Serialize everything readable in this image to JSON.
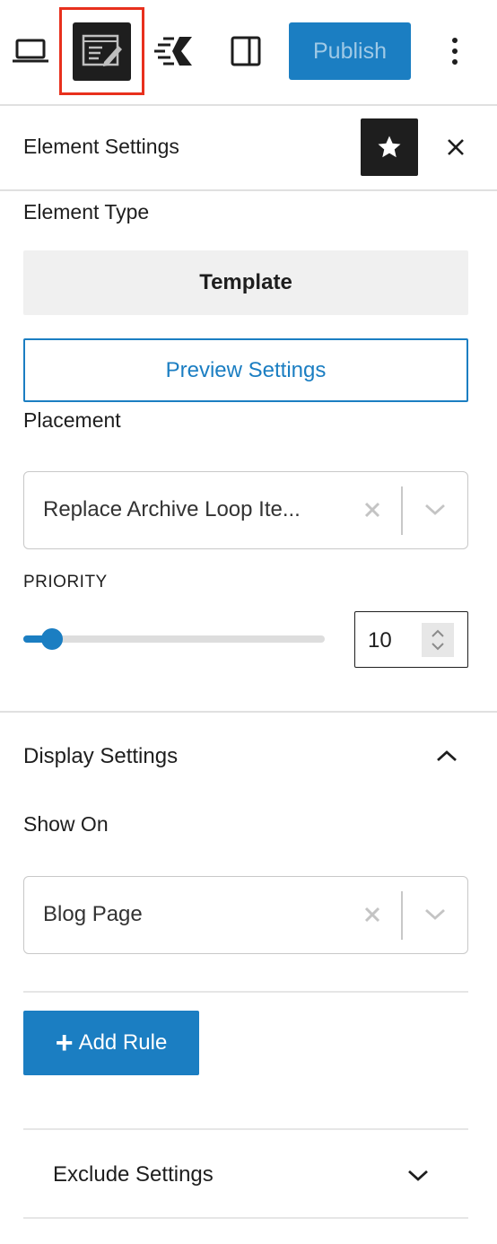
{
  "toolbar": {
    "publish_label": "Publish",
    "icons": [
      "desktop-icon",
      "elements-editor-icon",
      "speed-icon",
      "sidebar-toggle-icon",
      "more-options-icon"
    ],
    "selected_highlight_color": "#e8301d"
  },
  "panel": {
    "title": "Element Settings",
    "star_icon": "star-icon",
    "close_icon": "close-icon"
  },
  "element_type": {
    "label": "Element Type",
    "value": "Template",
    "preview_button": "Preview Settings"
  },
  "placement": {
    "label": "Placement",
    "value": "Replace Archive Loop Ite...",
    "priority_label": "PRIORITY",
    "priority_value": "10",
    "priority_fraction": 0.095
  },
  "display_settings": {
    "title": "Display Settings",
    "show_on_label": "Show On",
    "show_on_value": "Blog Page",
    "add_rule_label": "Add Rule"
  },
  "exclude_settings": {
    "title": "Exclude Settings"
  },
  "colors": {
    "accent": "#1b7ec2",
    "dark": "#1e1e1e",
    "border": "#c8c8c8"
  }
}
